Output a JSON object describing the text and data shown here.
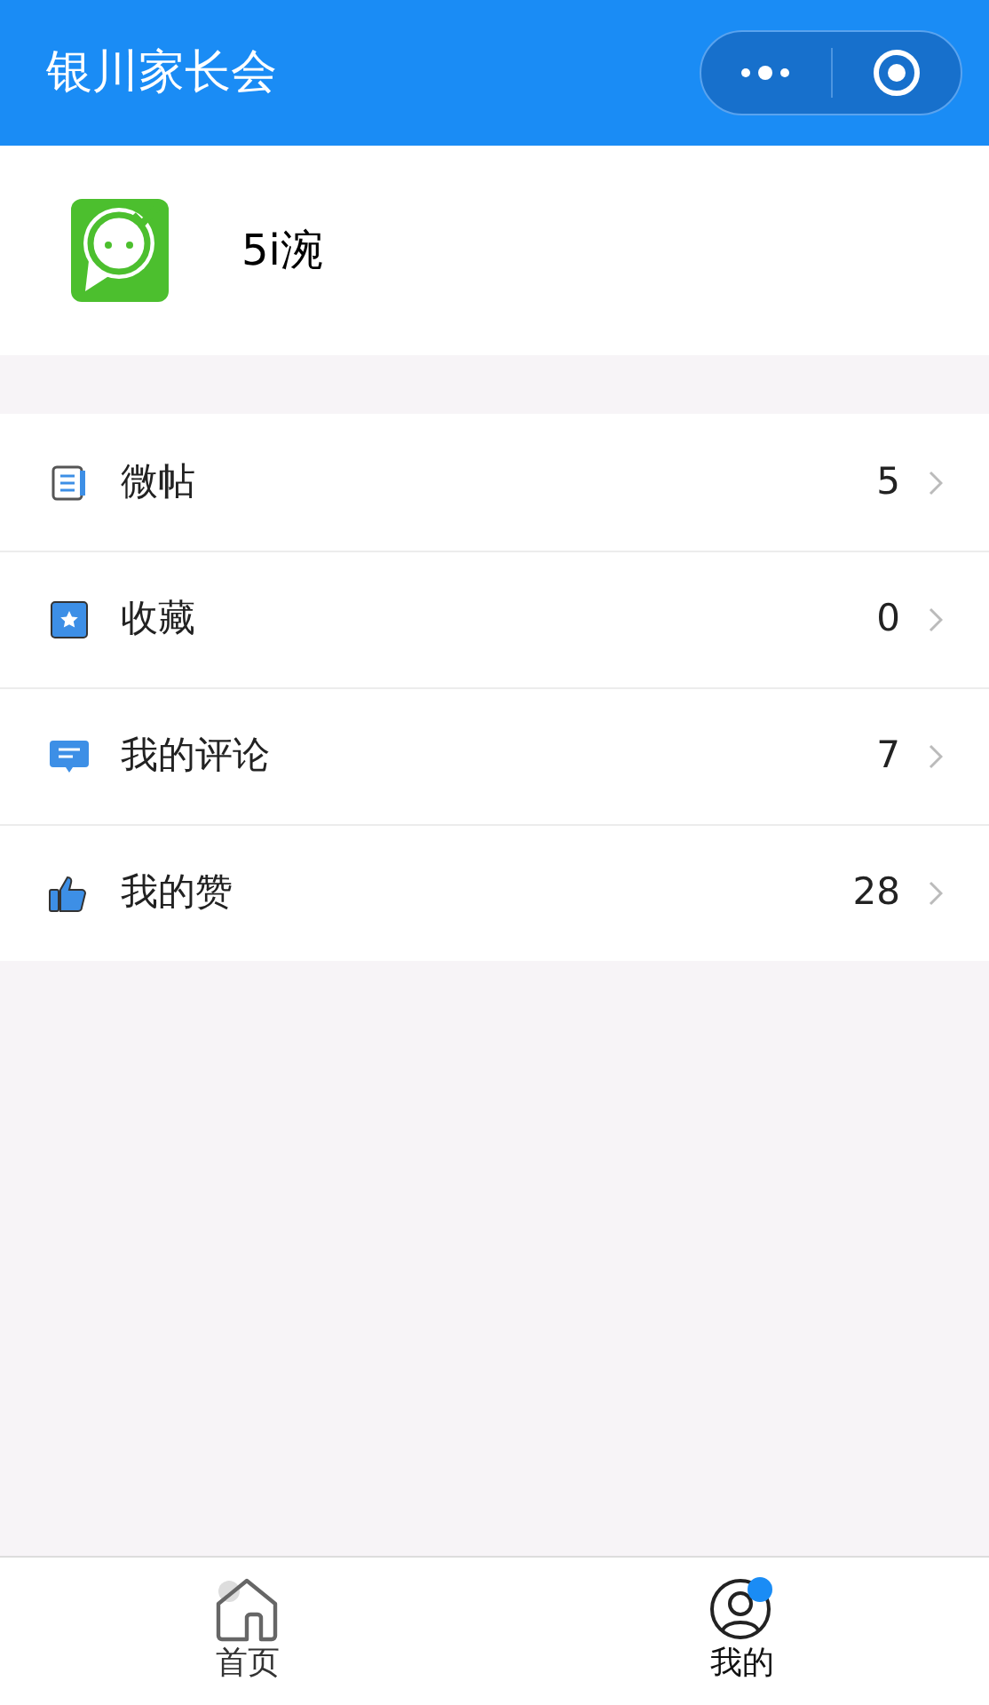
{
  "header": {
    "title": "银川家长会"
  },
  "profile": {
    "name": "5i涴"
  },
  "menu": [
    {
      "kind": "post",
      "label": "微帖",
      "count": "5"
    },
    {
      "kind": "favorite",
      "label": "收藏",
      "count": "0"
    },
    {
      "kind": "comment",
      "label": "我的评论",
      "count": "7"
    },
    {
      "kind": "like",
      "label": "我的赞",
      "count": "28"
    }
  ],
  "tabs": [
    {
      "kind": "home",
      "label": "首页",
      "selected": false
    },
    {
      "kind": "me",
      "label": "我的",
      "selected": true
    }
  ]
}
